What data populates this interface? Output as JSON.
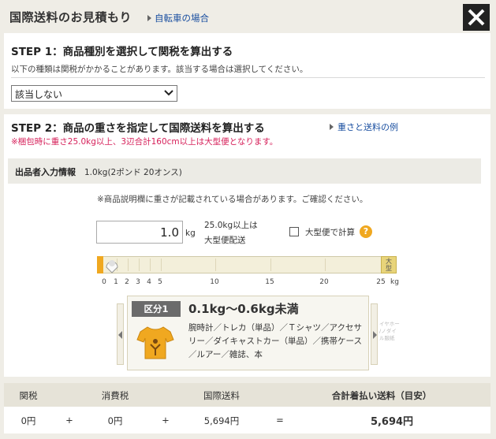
{
  "header": {
    "title": "国際送料のお見積もり",
    "bike_link": "自転車の場合"
  },
  "step1": {
    "heading": "STEP 1：商品種別を選択して関税を算出する",
    "description": "以下の種類は関税がかかることがあります。該当する場合は選択してください。",
    "select_value": "該当しない"
  },
  "step2": {
    "heading": "STEP 2：商品の重さを指定して国際送料を算出する",
    "warning": "※梱包時に重さ25.0kg以上、3辺合計160cm以上は大型便となります。",
    "example_link": "重さと送料の例",
    "seller_label": "出品者入力情報",
    "seller_value": "1.0kg(2ポンド 20オンス)",
    "notice": "※商品説明欄に重さが記載されている場合があります。ご確認ください。",
    "weight_value": "1.0",
    "weight_unit": "kg",
    "large_note_1": "25.0kg以上は",
    "large_note_2": "大型便配送",
    "large_checkbox_label": "大型便で計算",
    "help_icon": "?",
    "slider": {
      "value": 1.0,
      "min": 0,
      "max": 25,
      "ticks": [
        "0",
        "1",
        "2",
        "3",
        "4",
        "5",
        "10",
        "15",
        "20",
        "25"
      ],
      "unit": "kg",
      "end_label_1": "大",
      "end_label_2": "型"
    },
    "category": {
      "badge": "区分1",
      "range": "0.1kg〜0.6kg未満",
      "items": "腕時計／トレカ（単品）／Ｔシャツ／アクセサリー／ダイキャストカー（単品）／携帯ケース／ルアー／雑誌、本",
      "peek_text": "イヤホー /ノダイ ル服紙"
    }
  },
  "summary": {
    "headers": {
      "duty": "関税",
      "tax": "消費税",
      "shipping": "国際送料",
      "total": "合計着払い送料（目安）"
    },
    "values": {
      "duty": "0円",
      "plus1": "+",
      "tax": "0円",
      "plus2": "+",
      "shipping": "5,694円",
      "equals": "=",
      "total": "5,694円"
    }
  },
  "colors": {
    "link": "#1a4fa0",
    "warning": "#d6205a",
    "accent": "#f0a820"
  }
}
